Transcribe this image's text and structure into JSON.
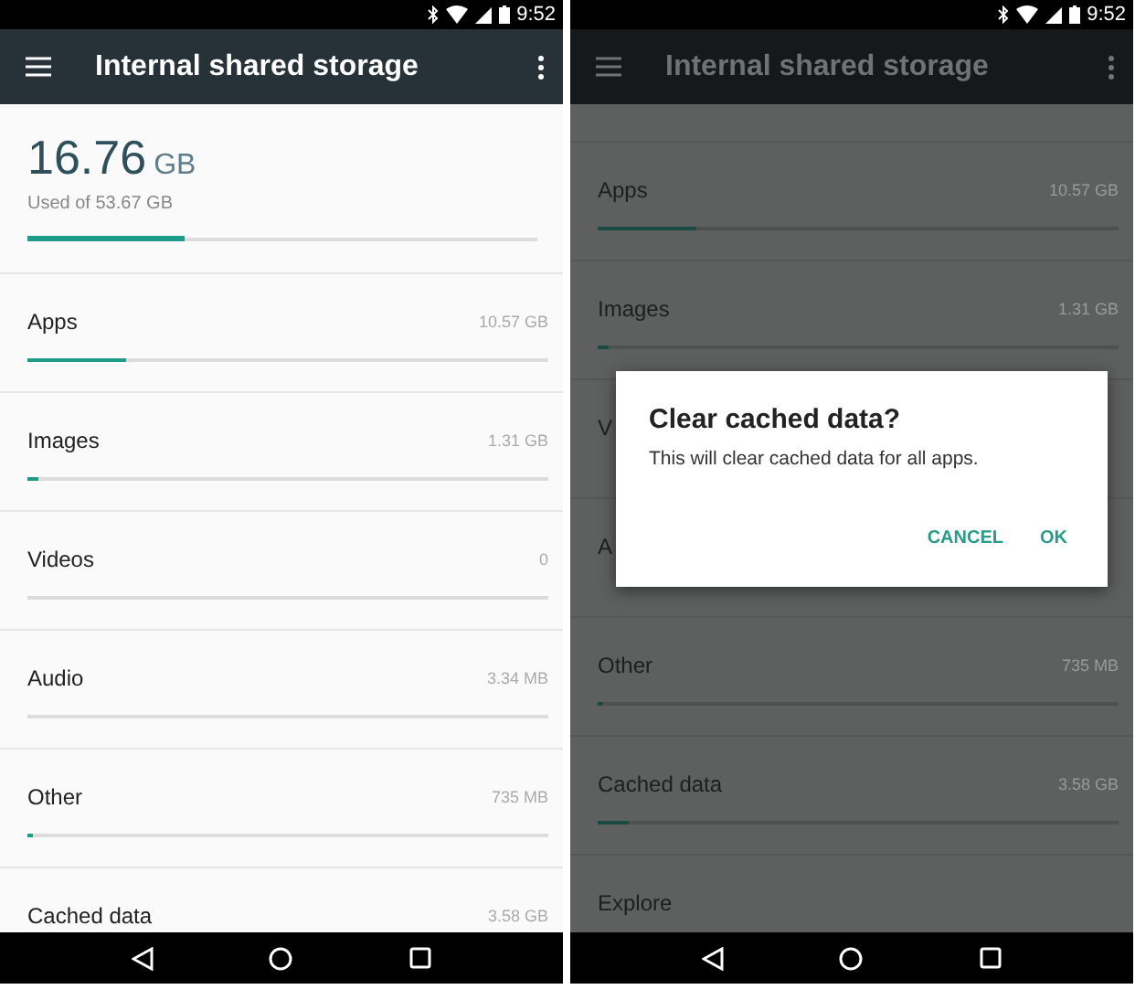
{
  "screens": [
    {
      "dimmed": false,
      "status_bar": {
        "time": "9:52"
      },
      "app_bar": {
        "title": "Internal shared storage"
      },
      "summary": {
        "amount": "16.76",
        "unit": "GB",
        "caption": "Used of 53.67 GB",
        "level": 0.31
      },
      "categories": [
        {
          "label": "Apps",
          "value": "10.57 GB",
          "level": 0.19
        },
        {
          "label": "Images",
          "value": "1.31 GB",
          "level": 0.02
        },
        {
          "label": "Videos",
          "value": "0",
          "level": 0
        },
        {
          "label": "Audio",
          "value": "3.34 MB",
          "level": 0
        },
        {
          "label": "Other",
          "value": "735 MB",
          "level": 0.01
        },
        {
          "label": "Cached data",
          "value": "3.58 GB"
        }
      ]
    },
    {
      "dimmed": true,
      "status_bar": {
        "time": "9:52"
      },
      "app_bar": {
        "title": "Internal shared storage"
      },
      "categories": [
        {
          "label": "Apps",
          "value": "10.57 GB",
          "level": 0.19
        },
        {
          "label": "Images",
          "value": "1.31 GB",
          "level": 0.02
        },
        {
          "label": "V"
        },
        {
          "label": "A"
        },
        {
          "label": "Other",
          "value": "735 MB",
          "level": 0.01
        },
        {
          "label": "Cached data",
          "value": "3.58 GB",
          "level": 0.06
        },
        {
          "label": "Explore"
        }
      ],
      "dialog": {
        "title": "Clear cached data?",
        "message": "This will clear cached data for all apps.",
        "buttons": [
          "CANCEL",
          "OK"
        ]
      }
    }
  ]
}
